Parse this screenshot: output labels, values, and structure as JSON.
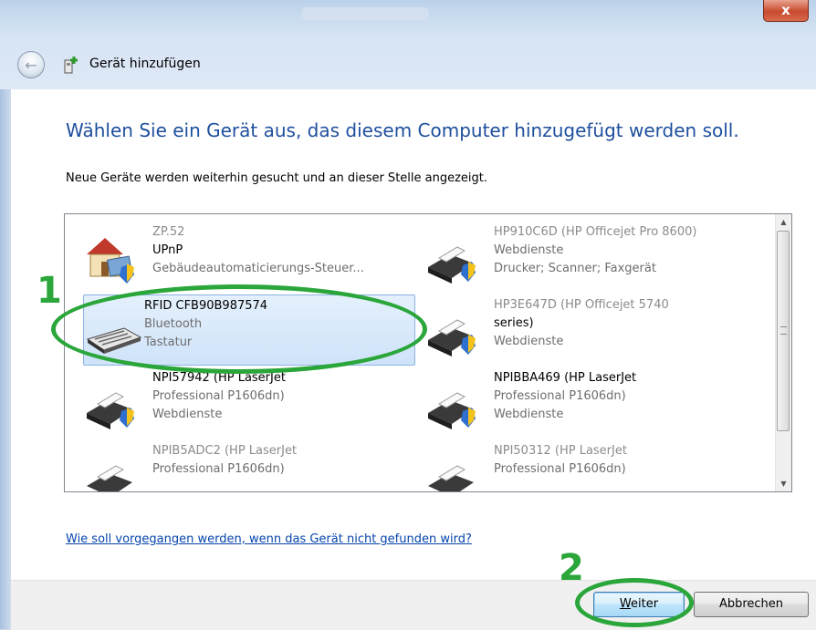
{
  "window": {
    "title": "Gerät hinzufügen",
    "close_glyph": "x",
    "back_glyph": "←"
  },
  "content": {
    "heading": "Wählen Sie ein Gerät aus, das diesem Computer hinzugefügt werden soll.",
    "subtext": "Neue Geräte werden weiterhin gesucht und an dieser Stelle angezeigt.",
    "help_link": "Wie soll vorgegangen werden, wenn das Gerät nicht gefunden wird?"
  },
  "devices": [
    {
      "name": "ZP.52",
      "lines": [
        "UPnP",
        "Gebäudeautomaticierungs-Steuer..."
      ],
      "icon": "home-automation-icon",
      "selected": false
    },
    {
      "name": "HP910C6D (HP Officejet Pro 8600)",
      "lines": [
        "Webdienste",
        "Drucker; Scanner; Faxgerät"
      ],
      "icon": "printer-icon",
      "selected": false
    },
    {
      "name": "RFID CFB90B987574",
      "lines": [
        "Bluetooth",
        "Tastatur"
      ],
      "icon": "keyboard-icon",
      "selected": true
    },
    {
      "name": "HP3E647D (HP Officejet 5740",
      "lines": [
        "series)",
        "Webdienste"
      ],
      "icon": "printer-icon",
      "selected": false
    },
    {
      "name": "NPI57942 (HP LaserJet",
      "lines": [
        "Professional P1606dn)",
        "Webdienste"
      ],
      "icon": "printer-icon",
      "selected": false
    },
    {
      "name": "NPIBBA469 (HP LaserJet",
      "lines": [
        "Professional P1606dn)",
        "Webdienste"
      ],
      "icon": "printer-icon",
      "selected": false
    },
    {
      "name": "NPIB5ADC2 (HP LaserJet",
      "lines": [
        "Professional P1606dn)",
        ""
      ],
      "icon": "printer-icon",
      "selected": false
    },
    {
      "name": "NPI50312 (HP LaserJet",
      "lines": [
        "Professional P1606dn)",
        ""
      ],
      "icon": "printer-icon",
      "selected": false
    }
  ],
  "scrollbar": {
    "up_glyph": "▲",
    "down_glyph": "▼"
  },
  "buttons": {
    "next_mnemonic": "W",
    "next_rest": "eiter",
    "cancel": "Abbrechen"
  },
  "annotations": {
    "step1": "1",
    "step2": "2",
    "color": "#2aa63a"
  }
}
